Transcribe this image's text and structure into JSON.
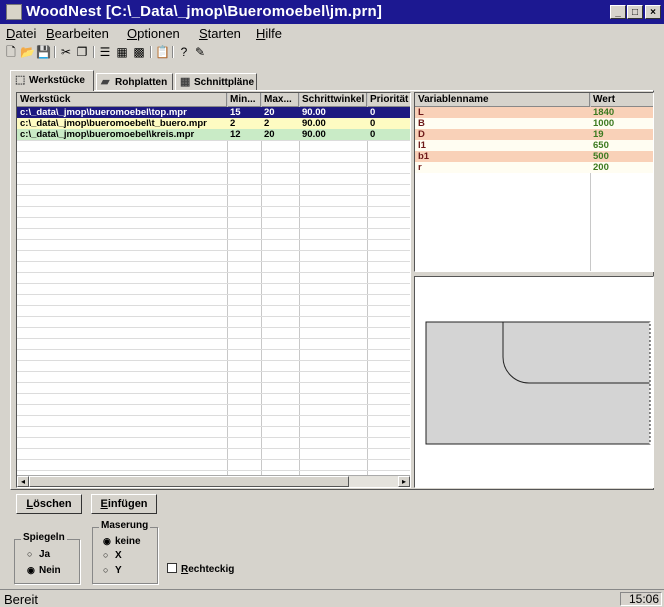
{
  "window": {
    "title": "WoodNest [C:\\_Data\\_jmop\\Bueromoebel\\jm.prn]"
  },
  "menu": [
    {
      "label": "Datei",
      "ul": "D",
      "rest": "atei"
    },
    {
      "label": "Bearbeiten",
      "ul": "B",
      "rest": "earbeiten"
    },
    {
      "label": "Optionen",
      "ul": "O",
      "rest": "ptionen"
    },
    {
      "label": "Starten",
      "ul": "S",
      "rest": "tarten"
    },
    {
      "label": "Hilfe",
      "ul": "H",
      "rest": "ilfe"
    }
  ],
  "toolbar_icons": [
    "new-file-icon",
    "open-folder-icon",
    "save-icon",
    "cut-icon",
    "copy-icon",
    "list-icon",
    "layout-icon",
    "palette-icon",
    "clipboard-icon",
    "help-icon",
    "run-icon"
  ],
  "tabs": [
    {
      "label": "Werkstücke",
      "icon": "part-icon",
      "active": true
    },
    {
      "label": "Rohplatten",
      "icon": "board-icon",
      "active": false
    },
    {
      "label": "Schnittpläne",
      "icon": "cutplan-icon",
      "active": false
    }
  ],
  "parts_table": {
    "columns": [
      "Werkstück",
      "Min...",
      "Max...",
      "Schrittwinkel",
      "Priorität"
    ],
    "rows": [
      {
        "werkstueck": "c:\\_data\\_jmop\\bueromoebel\\top.mpr",
        "min": "15",
        "max": "20",
        "winkel": "90.00",
        "prio": "0",
        "bg": "#1d1980",
        "fg": "#ffffff"
      },
      {
        "werkstueck": "c:\\_data\\_jmop\\bueromoebel\\t_buero.mpr",
        "min": "2",
        "max": "2",
        "winkel": "90.00",
        "prio": "0",
        "bg": "#fefbc2",
        "fg": "#000000"
      },
      {
        "werkstueck": "c:\\_data\\_jmop\\bueromoebel\\kreis.mpr",
        "min": "12",
        "max": "20",
        "winkel": "90.00",
        "prio": "0",
        "bg": "#c9ebc6",
        "fg": "#000000"
      }
    ]
  },
  "variables_table": {
    "columns": [
      "Variablenname",
      "Wert"
    ],
    "rows": [
      {
        "name": "L",
        "wert": "1840",
        "bg": "#f9d1b8"
      },
      {
        "name": "B",
        "wert": "1000",
        "bg": "#fffdf2"
      },
      {
        "name": "D",
        "wert": "19",
        "bg": "#f9d1b8"
      },
      {
        "name": "l1",
        "wert": "650",
        "bg": "#fffdf2"
      },
      {
        "name": "b1",
        "wert": "500",
        "bg": "#f9d1b8"
      },
      {
        "name": "r",
        "wert": "200",
        "bg": "#fffdf2"
      }
    ],
    "name_color": "#6e1a1a",
    "value_color": "#3c7a20"
  },
  "buttons": {
    "loeschen": {
      "u": "L",
      "rest": "öschen"
    },
    "einfuegen": {
      "u": "E",
      "rest": "infügen"
    }
  },
  "spiegeln": {
    "title": "Spiegeln",
    "options": [
      {
        "label": "Ja",
        "checked": false
      },
      {
        "label": "Nein",
        "checked": true
      }
    ]
  },
  "maserung": {
    "title": "Maserung",
    "options": [
      {
        "label": "keine",
        "checked": true
      },
      {
        "label": "X",
        "checked": false
      },
      {
        "label": "Y",
        "checked": false
      }
    ]
  },
  "rechteckig": {
    "u": "R",
    "rest": "echteckig",
    "checked": false
  },
  "status": {
    "text": "Bereit",
    "time": "15:06"
  }
}
